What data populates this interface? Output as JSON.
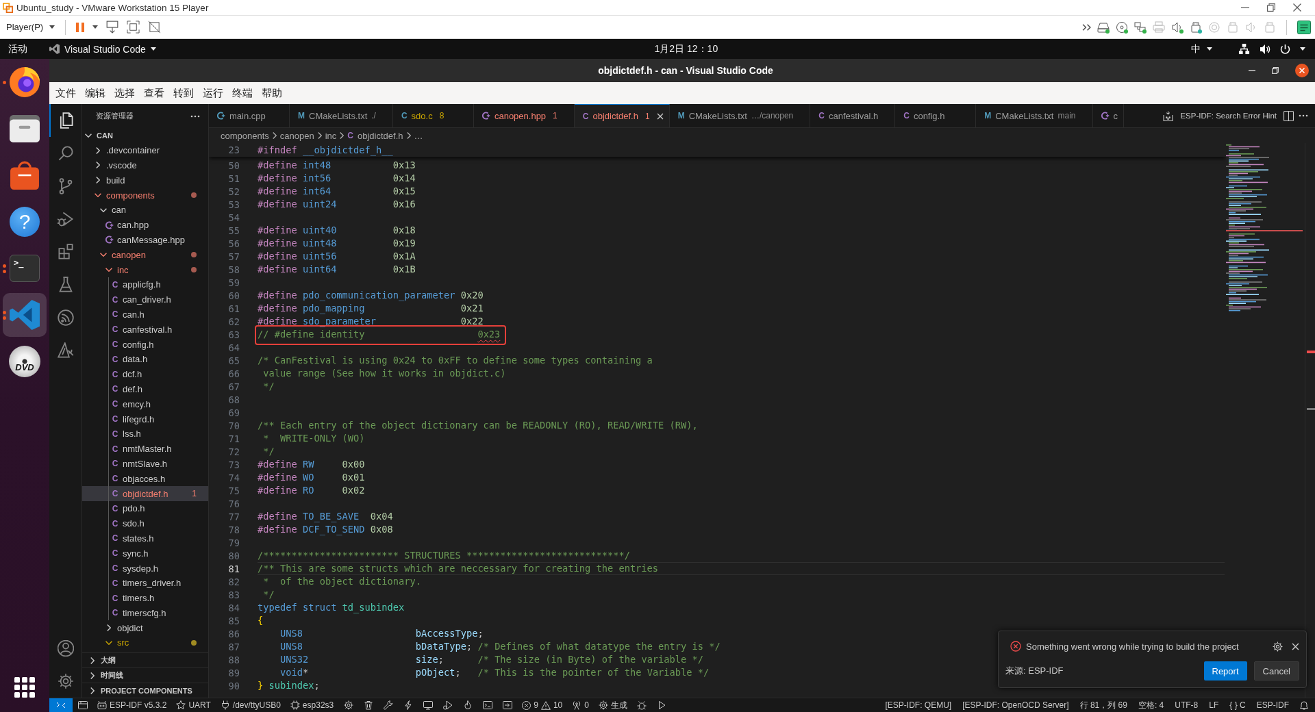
{
  "vmware": {
    "title": "Ubuntu_study - VMware Workstation 15 Player",
    "player_menu": "Player(P)",
    "devices": [
      {
        "kind": "hard-disk",
        "connected": true
      },
      {
        "kind": "cd",
        "connected": true
      },
      {
        "kind": "network",
        "connected": true
      },
      {
        "kind": "printer",
        "connected": false
      },
      {
        "kind": "sound",
        "connected": true
      },
      {
        "kind": "usb",
        "connected": true
      },
      {
        "kind": "camera",
        "connected": false
      },
      {
        "kind": "usb",
        "connected": false
      },
      {
        "kind": "sound",
        "connected": false
      },
      {
        "kind": "usb",
        "connected": false
      }
    ]
  },
  "top_bar": {
    "activities": "活动",
    "app_menu": "Visual Studio Code",
    "clock": "1月2日 12：10",
    "input_method": "中"
  },
  "dock": [
    {
      "kind": "browser",
      "running": true,
      "multi_window": false,
      "selected": false
    },
    {
      "kind": "files",
      "running": false,
      "selected": false
    },
    {
      "kind": "store",
      "running": false,
      "selected": false
    },
    {
      "kind": "help",
      "glyph": "?",
      "running": false,
      "selected": false
    },
    {
      "kind": "terminal",
      "glyph": ">_",
      "running": true,
      "multi_window": true,
      "selected": false
    },
    {
      "kind": "vscode",
      "running": true,
      "multi_window": true,
      "selected": true
    },
    {
      "kind": "dvd",
      "glyph": "DVD",
      "running": false,
      "selected": false
    }
  ],
  "window": {
    "title": "objdictdef.h - can - Visual Studio Code"
  },
  "menu": [
    "文件",
    "编辑",
    "选择",
    "查看",
    "转到",
    "运行",
    "终端",
    "帮助"
  ],
  "activity_bar": {
    "top": [
      {
        "kind": "explorer",
        "selected": true
      },
      {
        "kind": "search",
        "selected": false
      },
      {
        "kind": "source-control",
        "selected": false
      },
      {
        "kind": "run-debug",
        "selected": false
      },
      {
        "kind": "extensions",
        "selected": false
      },
      {
        "kind": "testing",
        "selected": false
      },
      {
        "kind": "esp-idf",
        "selected": false
      },
      {
        "kind": "esp-tools",
        "selected": false
      }
    ],
    "bottom": [
      {
        "kind": "accounts"
      },
      {
        "kind": "manage"
      }
    ]
  },
  "explorer": {
    "title": "资源管理器",
    "root": {
      "name": "CAN",
      "expanded": true,
      "children": [
        {
          "name": ".devcontainer",
          "kind": "folder",
          "expanded": false,
          "selected": false,
          "error": false,
          "warning": false
        },
        {
          "name": ".vscode",
          "kind": "folder",
          "expanded": false,
          "selected": false,
          "error": false,
          "warning": false
        },
        {
          "name": "build",
          "kind": "folder",
          "expanded": false,
          "selected": false,
          "error": false,
          "warning": false
        },
        {
          "name": "components",
          "kind": "folder",
          "expanded": true,
          "selected": false,
          "error": true,
          "children": [
            {
              "name": "can",
              "kind": "folder",
              "expanded": true,
              "selected": false,
              "error": false,
              "warning": false,
              "children": [
                {
                  "name": "can.hpp",
                  "kind": "cpp-header",
                  "selected": false,
                  "error": false,
                  "warning": false
                },
                {
                  "name": "canMessage.hpp",
                  "kind": "cpp-header",
                  "selected": false,
                  "error": false,
                  "warning": false
                }
              ]
            },
            {
              "name": "canopen",
              "kind": "folder",
              "expanded": true,
              "selected": false,
              "error": true,
              "children": [
                {
                  "name": "inc",
                  "kind": "folder",
                  "expanded": true,
                  "selected": false,
                  "error": true,
                  "children": [
                    {
                      "name": "applicfg.h",
                      "kind": "c-header",
                      "icon": "C",
                      "selected": false,
                      "error": false,
                      "warning": false
                    },
                    {
                      "name": "can_driver.h",
                      "kind": "c-header",
                      "icon": "C",
                      "selected": false,
                      "error": false,
                      "warning": false
                    },
                    {
                      "name": "can.h",
                      "kind": "c-header",
                      "icon": "C",
                      "selected": false,
                      "error": false,
                      "warning": false
                    },
                    {
                      "name": "canfestival.h",
                      "kind": "c-header",
                      "icon": "C",
                      "selected": false,
                      "error": false,
                      "warning": false
                    },
                    {
                      "name": "config.h",
                      "kind": "c-header",
                      "icon": "C",
                      "selected": false,
                      "error": false,
                      "warning": false
                    },
                    {
                      "name": "data.h",
                      "kind": "c-header",
                      "icon": "C",
                      "selected": false,
                      "error": false,
                      "warning": false
                    },
                    {
                      "name": "dcf.h",
                      "kind": "c-header",
                      "icon": "C",
                      "selected": false,
                      "error": false,
                      "warning": false
                    },
                    {
                      "name": "def.h",
                      "kind": "c-header",
                      "icon": "C",
                      "selected": false,
                      "error": false,
                      "warning": false
                    },
                    {
                      "name": "emcy.h",
                      "kind": "c-header",
                      "icon": "C",
                      "selected": false,
                      "error": false,
                      "warning": false
                    },
                    {
                      "name": "lifegrd.h",
                      "kind": "c-header",
                      "icon": "C",
                      "selected": false,
                      "error": false,
                      "warning": false
                    },
                    {
                      "name": "lss.h",
                      "kind": "c-header",
                      "icon": "C",
                      "selected": false,
                      "error": false,
                      "warning": false
                    },
                    {
                      "name": "nmtMaster.h",
                      "kind": "c-header",
                      "icon": "C",
                      "selected": false,
                      "error": false,
                      "warning": false
                    },
                    {
                      "name": "nmtSlave.h",
                      "kind": "c-header",
                      "icon": "C",
                      "selected": false,
                      "error": false,
                      "warning": false
                    },
                    {
                      "name": "objacces.h",
                      "kind": "c-header",
                      "icon": "C",
                      "selected": false,
                      "error": false,
                      "warning": false
                    },
                    {
                      "name": "objdictdef.h",
                      "kind": "c-header",
                      "icon": "C",
                      "selected": true,
                      "error": true,
                      "badge": "1"
                    },
                    {
                      "name": "pdo.h",
                      "kind": "c-header",
                      "icon": "C",
                      "selected": false,
                      "error": false,
                      "warning": false
                    },
                    {
                      "name": "sdo.h",
                      "kind": "c-header",
                      "icon": "C",
                      "selected": false,
                      "error": false,
                      "warning": false
                    },
                    {
                      "name": "states.h",
                      "kind": "c-header",
                      "icon": "C",
                      "selected": false,
                      "error": false,
                      "warning": false
                    },
                    {
                      "name": "sync.h",
                      "kind": "c-header",
                      "icon": "C",
                      "selected": false,
                      "error": false,
                      "warning": false
                    },
                    {
                      "name": "sysdep.h",
                      "kind": "c-header",
                      "icon": "C",
                      "selected": false,
                      "error": false,
                      "warning": false
                    },
                    {
                      "name": "timers_driver.h",
                      "kind": "c-header",
                      "icon": "C",
                      "selected": false,
                      "error": false,
                      "warning": false
                    },
                    {
                      "name": "timers.h",
                      "kind": "c-header",
                      "icon": "C",
                      "selected": false,
                      "error": false,
                      "warning": false
                    },
                    {
                      "name": "timerscfg.h",
                      "kind": "c-header",
                      "icon": "C",
                      "selected": false,
                      "error": false,
                      "warning": false
                    }
                  ]
                },
                {
                  "name": "objdict",
                  "kind": "folder",
                  "expanded": false,
                  "selected": false,
                  "error": false,
                  "warning": false
                },
                {
                  "name": "src",
                  "kind": "folder",
                  "expanded": true,
                  "selected": false,
                  "error": false,
                  "warning": true
                }
              ]
            }
          ]
        }
      ]
    },
    "sections": [
      {
        "name": "大纲",
        "expanded": false
      },
      {
        "name": "时间线",
        "expanded": false
      },
      {
        "name": "PROJECT COMPONENTS",
        "expanded": false
      }
    ]
  },
  "tabs": [
    {
      "name": "main.cpp",
      "kind": "cpp-source",
      "error": false,
      "warning": false,
      "selected": false
    },
    {
      "name": "CMakeLists.txt",
      "kind": "cmake",
      "icon": "M",
      "description": "./",
      "error": false,
      "warning": false,
      "selected": false
    },
    {
      "name": "sdo.c",
      "kind": "c-source",
      "icon": "C",
      "badge": "8",
      "error": false,
      "warning": true,
      "selected": false
    },
    {
      "name": "canopen.hpp",
      "kind": "cpp-header",
      "badge": "1",
      "error": true,
      "selected": false
    },
    {
      "name": "objdictdef.h",
      "kind": "c-header",
      "icon": "C",
      "badge": "1",
      "error": true,
      "selected": true
    },
    {
      "name": "CMakeLists.txt",
      "kind": "cmake",
      "icon": "M",
      "description": "…/canopen",
      "error": false,
      "warning": false,
      "selected": false
    },
    {
      "name": "canfestival.h",
      "kind": "c-header",
      "icon": "C",
      "error": false,
      "warning": false,
      "selected": false
    },
    {
      "name": "config.h",
      "kind": "c-header",
      "icon": "C",
      "error": false,
      "warning": false,
      "selected": false
    },
    {
      "name": "CMakeLists.txt",
      "kind": "cmake",
      "icon": "M",
      "description": "main",
      "error": false,
      "warning": false,
      "selected": false
    },
    {
      "name": "c",
      "kind": "cpp-header",
      "error": false,
      "warning": false,
      "selected": false
    }
  ],
  "editor_actions": {
    "hint": "ESP-IDF: Search Error Hint"
  },
  "breadcrumbs": [
    {
      "text": "components",
      "kind": "folder"
    },
    {
      "text": "canopen",
      "kind": "folder"
    },
    {
      "text": "inc",
      "kind": "folder"
    },
    {
      "text": "objdictdef.h",
      "kind": "c-header",
      "icon": "C"
    },
    {
      "text": "…",
      "kind": "symbol"
    }
  ],
  "editor": {
    "sticky": [
      {
        "n": "23",
        "tokens": [
          {
            "text": "#ifndef",
            "kind": "directive"
          },
          {
            "text": " __objdictdef_h__",
            "kind": "macro"
          }
        ]
      }
    ],
    "lines": [
      {
        "n": "50",
        "current": false,
        "boxed": false,
        "tokens": [
          {
            "text": "#define",
            "kind": "directive"
          },
          {
            "text": " int48",
            "kind": "macro"
          },
          {
            "text": "           0x13",
            "kind": "number"
          }
        ]
      },
      {
        "n": "51",
        "current": false,
        "boxed": false,
        "tokens": [
          {
            "text": "#define",
            "kind": "directive"
          },
          {
            "text": " int56",
            "kind": "macro"
          },
          {
            "text": "           0x14",
            "kind": "number"
          }
        ]
      },
      {
        "n": "52",
        "current": false,
        "boxed": false,
        "tokens": [
          {
            "text": "#define",
            "kind": "directive"
          },
          {
            "text": " int64",
            "kind": "macro"
          },
          {
            "text": "           0x15",
            "kind": "number"
          }
        ]
      },
      {
        "n": "53",
        "current": false,
        "boxed": false,
        "tokens": [
          {
            "text": "#define",
            "kind": "directive"
          },
          {
            "text": " uint24",
            "kind": "macro"
          },
          {
            "text": "          0x16",
            "kind": "number"
          }
        ]
      },
      {
        "n": "54",
        "current": false,
        "boxed": false
      },
      {
        "n": "55",
        "current": false,
        "boxed": false,
        "tokens": [
          {
            "text": "#define",
            "kind": "directive"
          },
          {
            "text": " uint40",
            "kind": "macro"
          },
          {
            "text": "          0x18",
            "kind": "number"
          }
        ]
      },
      {
        "n": "56",
        "current": false,
        "boxed": false,
        "tokens": [
          {
            "text": "#define",
            "kind": "directive"
          },
          {
            "text": " uint48",
            "kind": "macro"
          },
          {
            "text": "          0x19",
            "kind": "number"
          }
        ]
      },
      {
        "n": "57",
        "current": false,
        "boxed": false,
        "tokens": [
          {
            "text": "#define",
            "kind": "directive"
          },
          {
            "text": " uint56",
            "kind": "macro"
          },
          {
            "text": "          0x1A",
            "kind": "number"
          }
        ]
      },
      {
        "n": "58",
        "current": false,
        "boxed": false,
        "tokens": [
          {
            "text": "#define",
            "kind": "directive"
          },
          {
            "text": " uint64",
            "kind": "macro"
          },
          {
            "text": "          0x1B",
            "kind": "number"
          }
        ]
      },
      {
        "n": "59",
        "current": false,
        "boxed": false
      },
      {
        "n": "60",
        "current": false,
        "boxed": false,
        "tokens": [
          {
            "text": "#define",
            "kind": "directive"
          },
          {
            "text": " pdo_communication_parameter",
            "kind": "macro"
          },
          {
            "text": " 0x20",
            "kind": "number"
          }
        ]
      },
      {
        "n": "61",
        "current": false,
        "boxed": false,
        "tokens": [
          {
            "text": "#define",
            "kind": "directive"
          },
          {
            "text": " pdo_mapping",
            "kind": "macro"
          },
          {
            "text": "                 0x21",
            "kind": "number"
          }
        ]
      },
      {
        "n": "62",
        "current": false,
        "boxed": false,
        "tokens": [
          {
            "text": "#define",
            "kind": "directive"
          },
          {
            "text": " sdo_parameter",
            "kind": "macro"
          },
          {
            "text": "               0x22",
            "kind": "number"
          }
        ]
      },
      {
        "n": "63",
        "current": false,
        "boxed": true,
        "tokens": [
          {
            "text": "// #define identity                    ",
            "kind": "comment"
          },
          {
            "text": "0x23",
            "kind": "flagged"
          }
        ]
      },
      {
        "n": "64",
        "current": false,
        "boxed": false
      },
      {
        "n": "65",
        "current": false,
        "boxed": false,
        "tokens": [
          {
            "text": "/* CanFestival is using 0x24 to 0xFF to define some types containing a",
            "kind": "comment"
          }
        ]
      },
      {
        "n": "66",
        "current": false,
        "boxed": false,
        "tokens": [
          {
            "text": " value range (See how it works in objdict.c)",
            "kind": "comment"
          }
        ]
      },
      {
        "n": "67",
        "current": false,
        "boxed": false,
        "tokens": [
          {
            "text": " */",
            "kind": "comment"
          }
        ]
      },
      {
        "n": "68",
        "current": false,
        "boxed": false
      },
      {
        "n": "69",
        "current": false,
        "boxed": false
      },
      {
        "n": "70",
        "current": false,
        "boxed": false,
        "tokens": [
          {
            "text": "/** Each entry of the object dictionary can be READONLY (RO), READ/WRITE (RW),",
            "kind": "comment"
          }
        ]
      },
      {
        "n": "71",
        "current": false,
        "boxed": false,
        "tokens": [
          {
            "text": " *  WRITE-ONLY (WO)",
            "kind": "comment"
          }
        ]
      },
      {
        "n": "72",
        "current": false,
        "boxed": false,
        "tokens": [
          {
            "text": " */",
            "kind": "comment"
          }
        ]
      },
      {
        "n": "73",
        "current": false,
        "boxed": false,
        "tokens": [
          {
            "text": "#define",
            "kind": "directive"
          },
          {
            "text": " RW",
            "kind": "macro"
          },
          {
            "text": "     0x00",
            "kind": "number"
          }
        ]
      },
      {
        "n": "74",
        "current": false,
        "boxed": false,
        "tokens": [
          {
            "text": "#define",
            "kind": "directive"
          },
          {
            "text": " WO",
            "kind": "macro"
          },
          {
            "text": "     0x01",
            "kind": "number"
          }
        ]
      },
      {
        "n": "75",
        "current": false,
        "boxed": false,
        "tokens": [
          {
            "text": "#define",
            "kind": "directive"
          },
          {
            "text": " RO",
            "kind": "macro"
          },
          {
            "text": "     0x02",
            "kind": "number"
          }
        ]
      },
      {
        "n": "76",
        "current": false,
        "boxed": false
      },
      {
        "n": "77",
        "current": false,
        "boxed": false,
        "tokens": [
          {
            "text": "#define",
            "kind": "directive"
          },
          {
            "text": " TO_BE_SAVE",
            "kind": "macro"
          },
          {
            "text": "  0x04",
            "kind": "number"
          }
        ]
      },
      {
        "n": "78",
        "current": false,
        "boxed": false,
        "tokens": [
          {
            "text": "#define",
            "kind": "directive"
          },
          {
            "text": " DCF_TO_SEND",
            "kind": "macro"
          },
          {
            "text": " 0x08",
            "kind": "number"
          }
        ]
      },
      {
        "n": "79",
        "current": false,
        "boxed": false
      },
      {
        "n": "80",
        "current": false,
        "boxed": false,
        "tokens": [
          {
            "text": "/************************ STRUCTURES ****************************/",
            "kind": "comment"
          }
        ]
      },
      {
        "n": "81",
        "current": true,
        "boxed": false,
        "tokens": [
          {
            "text": "/** This are some structs which are neccessary for creating the entries",
            "kind": "comment"
          }
        ]
      },
      {
        "n": "82",
        "current": false,
        "boxed": false,
        "tokens": [
          {
            "text": " *  of the object dictionary.",
            "kind": "comment"
          }
        ]
      },
      {
        "n": "83",
        "current": false,
        "boxed": false,
        "tokens": [
          {
            "text": " */",
            "kind": "comment"
          }
        ]
      },
      {
        "n": "84",
        "current": false,
        "boxed": false,
        "tokens": [
          {
            "text": "typedef",
            "kind": "keyword"
          },
          {
            "text": " struct",
            "kind": "keyword"
          },
          {
            "text": " td_subindex",
            "kind": "type"
          }
        ]
      },
      {
        "n": "85",
        "current": false,
        "boxed": false,
        "tokens": [
          {
            "text": "{",
            "kind": "brace"
          }
        ]
      },
      {
        "n": "86",
        "current": false,
        "boxed": false,
        "tokens": [
          {
            "text": "    UNS8",
            "kind": "macro"
          },
          {
            "text": "                    bAccessType",
            "kind": "field"
          },
          {
            "text": ";",
            "kind": "plain"
          }
        ]
      },
      {
        "n": "87",
        "current": false,
        "boxed": false,
        "tokens": [
          {
            "text": "    UNS8",
            "kind": "macro"
          },
          {
            "text": "                    bDataType",
            "kind": "field"
          },
          {
            "text": ";",
            "kind": "plain"
          },
          {
            "text": " /* Defines of what datatype the entry is */",
            "kind": "comment"
          }
        ]
      },
      {
        "n": "88",
        "current": false,
        "boxed": false,
        "tokens": [
          {
            "text": "    UNS32",
            "kind": "macro"
          },
          {
            "text": "                   size",
            "kind": "field"
          },
          {
            "text": ";",
            "kind": "plain"
          },
          {
            "text": "      /* The size (in Byte) of the variable */",
            "kind": "comment"
          }
        ]
      },
      {
        "n": "89",
        "current": false,
        "boxed": false,
        "tokens": [
          {
            "text": "    void",
            "kind": "keyword"
          },
          {
            "text": "*",
            "kind": "plain"
          },
          {
            "text": "                   pObject",
            "kind": "field"
          },
          {
            "text": ";",
            "kind": "plain"
          },
          {
            "text": "   /* This is the pointer of the Variable */",
            "kind": "comment"
          }
        ]
      },
      {
        "n": "90",
        "current": false,
        "boxed": false,
        "tokens": [
          {
            "text": "}",
            "kind": "brace"
          },
          {
            "text": " subindex",
            "kind": "type"
          },
          {
            "text": ";",
            "kind": "plain"
          }
        ]
      }
    ]
  },
  "notification": {
    "message": "Something went wrong while trying to build the project",
    "source": "来源: ESP-IDF",
    "buttons": [
      {
        "label": "Report",
        "kind": "primary"
      },
      {
        "label": "Cancel",
        "kind": "secondary"
      }
    ]
  },
  "status_bar": {
    "left": [
      {
        "kind": "remote"
      },
      {
        "kind": "workspace"
      },
      {
        "kind": "idf-version",
        "text": "ESP-IDF v5.3.2"
      },
      {
        "kind": "flash-method",
        "text": "UART"
      },
      {
        "kind": "port",
        "text": "/dev/ttyUSB0"
      },
      {
        "kind": "target",
        "text": "esp32s3"
      },
      {
        "kind": "sdkconfig"
      },
      {
        "kind": "full-clean"
      },
      {
        "kind": "build"
      },
      {
        "kind": "flash"
      },
      {
        "kind": "monitor"
      },
      {
        "kind": "debug-launch"
      },
      {
        "kind": "build-flash-monitor"
      },
      {
        "kind": "terminal"
      },
      {
        "kind": "custom-task"
      },
      {
        "kind": "problems",
        "errors": "9",
        "warnings": "10"
      },
      {
        "kind": "ports",
        "text": "0"
      },
      {
        "kind": "cmake-build",
        "text": "生成"
      },
      {
        "kind": "debug"
      },
      {
        "kind": "run"
      }
    ],
    "right": [
      {
        "kind": "text",
        "text": "[ESP-IDF: QEMU]"
      },
      {
        "kind": "text",
        "text": "[ESP-IDF: OpenOCD Server]"
      },
      {
        "kind": "text",
        "text": "行 81，列 69"
      },
      {
        "kind": "text",
        "text": "空格: 4"
      },
      {
        "kind": "text",
        "text": "UTF-8"
      },
      {
        "kind": "text",
        "text": "LF"
      },
      {
        "kind": "text",
        "text": "{ } C"
      },
      {
        "kind": "text",
        "text": "ESP-IDF"
      },
      {
        "kind": "notifications"
      }
    ]
  }
}
